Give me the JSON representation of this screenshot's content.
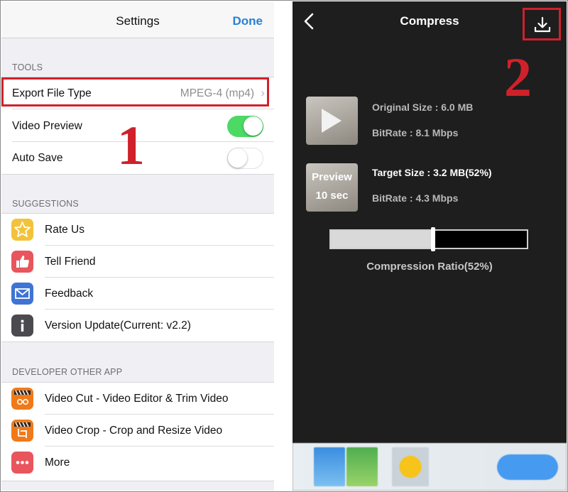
{
  "settings": {
    "title": "Settings",
    "done_label": "Done",
    "tools_header": "TOOLS",
    "tools": {
      "export_label": "Export File Type",
      "export_value": "MPEG-4 (mp4)",
      "video_preview_label": "Video Preview",
      "video_preview_on": true,
      "auto_save_label": "Auto Save",
      "auto_save_on": false
    },
    "suggestions_header": "SUGGESTIONS",
    "suggestions": [
      {
        "label": "Rate Us",
        "icon": "star-icon"
      },
      {
        "label": "Tell Friend",
        "icon": "thumbs-up-icon"
      },
      {
        "label": "Feedback",
        "icon": "mail-icon"
      },
      {
        "label": "Version Update(Current: v2.2)",
        "icon": "info-icon"
      }
    ],
    "developer_header": "DEVELOPER OTHER APP",
    "developer_apps": [
      {
        "label": "Video Cut - Video Editor & Trim Video",
        "icon": "video-cut-app-icon"
      },
      {
        "label": "Video Crop - Crop and Resize Video",
        "icon": "video-crop-app-icon"
      },
      {
        "label": "More",
        "icon": "more-icon"
      }
    ]
  },
  "compress": {
    "title": "Compress",
    "original_size": "Original Size : 6.0 MB",
    "original_bitrate": "BitRate : 8.1 Mbps",
    "preview_line1": "Preview",
    "preview_line2": "10 sec",
    "target_size": "Target Size : 3.2 MB(52%)",
    "target_bitrate": "BitRate : 4.3 Mbps",
    "compression_ratio": 0.52,
    "ratio_label": "Compression Ratio(52%)"
  },
  "annotations": {
    "step1": "1",
    "step2": "2"
  },
  "colors": {
    "annotation_red": "#d0212b",
    "ios_blue": "#2a7fd6",
    "toggle_green": "#4cd964"
  }
}
